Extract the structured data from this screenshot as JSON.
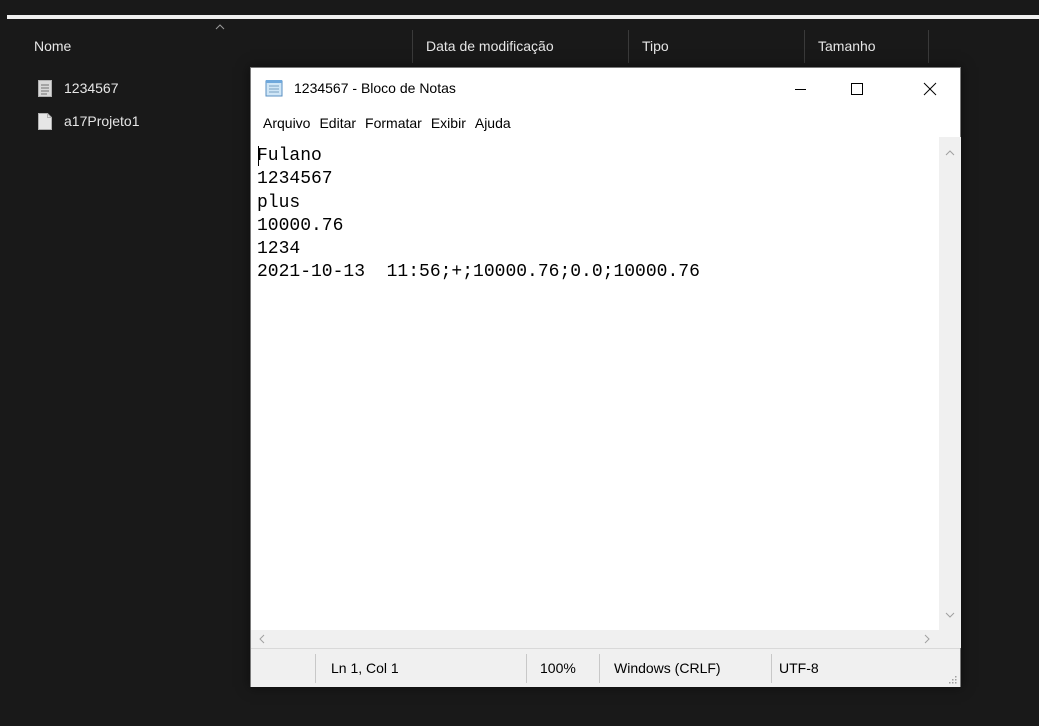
{
  "explorer": {
    "columns": {
      "name": "Nome",
      "modified": "Data de modificação",
      "type": "Tipo",
      "size": "Tamanho"
    },
    "files": [
      {
        "name": "1234567",
        "icon": "text-file-icon"
      },
      {
        "name": "a17Projeto1",
        "icon": "document-file-icon"
      }
    ]
  },
  "notepad": {
    "title": "1234567 - Bloco de Notas",
    "menu": [
      "Arquivo",
      "Editar",
      "Formatar",
      "Exibir",
      "Ajuda"
    ],
    "content": "Fulano\n1234567\nplus\n10000.76\n1234\n2021-10-13  11:56;+;10000.76;0.0;10000.76",
    "status": {
      "position": "Ln 1, Col 1",
      "zoom": "100%",
      "line_ending": "Windows (CRLF)",
      "encoding": "UTF-8"
    }
  },
  "colors": {
    "explorer_bg": "#191919",
    "notepad_bg": "#ffffff",
    "statusbar_bg": "#f0f0f0"
  }
}
